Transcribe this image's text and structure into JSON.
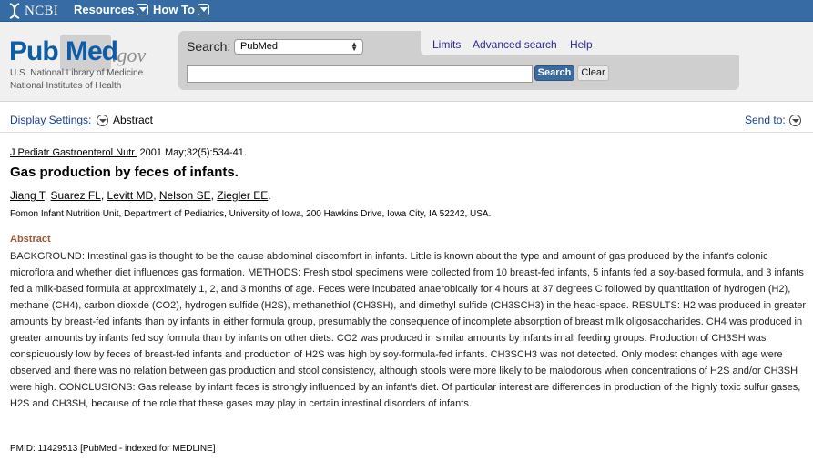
{
  "topbar": {
    "logo_text": "NCBI",
    "resources_label": "Resources",
    "howto_label": "How To"
  },
  "header": {
    "logo_pub": "Pub",
    "logo_med": "Med",
    "logo_gov": ".gov",
    "nlm_line1": "U.S. National Library of Medicine",
    "nlm_line2": "National Institutes of Health",
    "search_label": "Search:",
    "database_selected": "PubMed",
    "search_value": "",
    "search_button": "Search",
    "clear_button": "Clear",
    "links": {
      "limits": "Limits",
      "advanced": "Advanced search",
      "help": "Help"
    }
  },
  "display_bar": {
    "display_settings": "Display Settings:",
    "mode": "Abstract",
    "send_to": "Send to:"
  },
  "article": {
    "journal": "J Pediatr Gastroenterol Nutr.",
    "citation_rest": " 2001 May;32(5):534-41.",
    "title": "Gas production by feces of infants.",
    "authors": [
      "Jiang T",
      "Suarez FL",
      "Levitt MD",
      "Nelson SE",
      "Ziegler EE"
    ],
    "author_sep": ", ",
    "authors_end": ".",
    "affiliation": "Fomon Infant Nutrition Unit, Department of Pediatrics, University of Iowa, 200 Hawkins Drive, Iowa City, IA 52242, USA.",
    "abstract_heading": "Abstract",
    "abstract": "BACKGROUND: Intestinal gas is thought to be the cause abdominal discomfort in infants. Little is known about the type and amount of gas produced by the infant's colonic microflora and whether diet influences gas formation. METHODS: Fresh stool specimens were collected from 10 breast-fed infants, 5 infants fed a soy-based formula, and 3 infants fed a milk-based formula at approximately 1, 2, and 3 months of age. Feces were incubated anaerobically for 4 hours at 37 degrees C followed by quantitation of hydrogen (H2), methane (CH4), carbon dioxide (CO2), hydrogen sulfide (H2S), methanethiol (CH3SH), and dimethyl sulfide (CH3SCH3) in the head-space. RESULTS: H2 was produced in greater amounts by breast-fed infants than by infants in either formula group, presumably the consequence of incomplete absorption of breast milk oligosaccharides. CH4 was produced in greater amounts by infants fed soy formula than by infants on other diets. CO2 was produced in similar amounts by infants in all feeding groups. Production of CH3SH was conspicuously low by feces of breast-fed infants and production of H2S was high by soy-formula-fed infants. CH3SCH3 was not detected. Only modest changes with age were observed and there was no relation between gas production and stool consistency, although stools were more likely to be malodorous when concentrations of H2S and/or CH3SH were high. CONCLUSIONS: Gas release by infant feces is strongly influenced by an infant's diet. Of particular interest are differences in production of the highly toxic sulfur gases, H2S and CH3SH, because of the role that these gases may play in certain intestinal disorders of infants.",
    "pmid": "PMID: 11429513 [PubMed - indexed for MEDLINE]"
  },
  "colors": {
    "topbar": "#366ca3",
    "link": "#1b3f8b",
    "abstract_heading": "#985735",
    "search_button": "#3a6aa0"
  }
}
